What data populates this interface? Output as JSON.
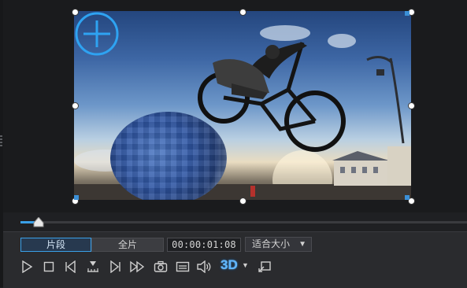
{
  "player": {
    "mode_tabs": [
      {
        "label": "片段",
        "active": true
      },
      {
        "label": "全片",
        "active": false
      }
    ],
    "timecode": "00:00:01:08",
    "fit_select": {
      "value": "适合大小",
      "arrow": "▼"
    },
    "badge_3d": "3D",
    "badge_3d_arrow": "▼",
    "timeline_progress": 0.04
  },
  "controls": [
    {
      "name": "play-icon"
    },
    {
      "name": "stop-icon"
    },
    {
      "name": "previous-frame-icon"
    },
    {
      "name": "mark-in-icon"
    },
    {
      "name": "next-frame-icon"
    },
    {
      "name": "fast-forward-icon"
    },
    {
      "name": "snapshot-icon"
    },
    {
      "name": "subtitle-icon"
    },
    {
      "name": "volume-icon"
    },
    {
      "name": "3d-mode-icon"
    },
    {
      "name": "detach-preview-icon"
    }
  ],
  "colors": {
    "accent": "#3aa0e8",
    "background": "#1f2023",
    "panel": "#2a2b2e"
  }
}
